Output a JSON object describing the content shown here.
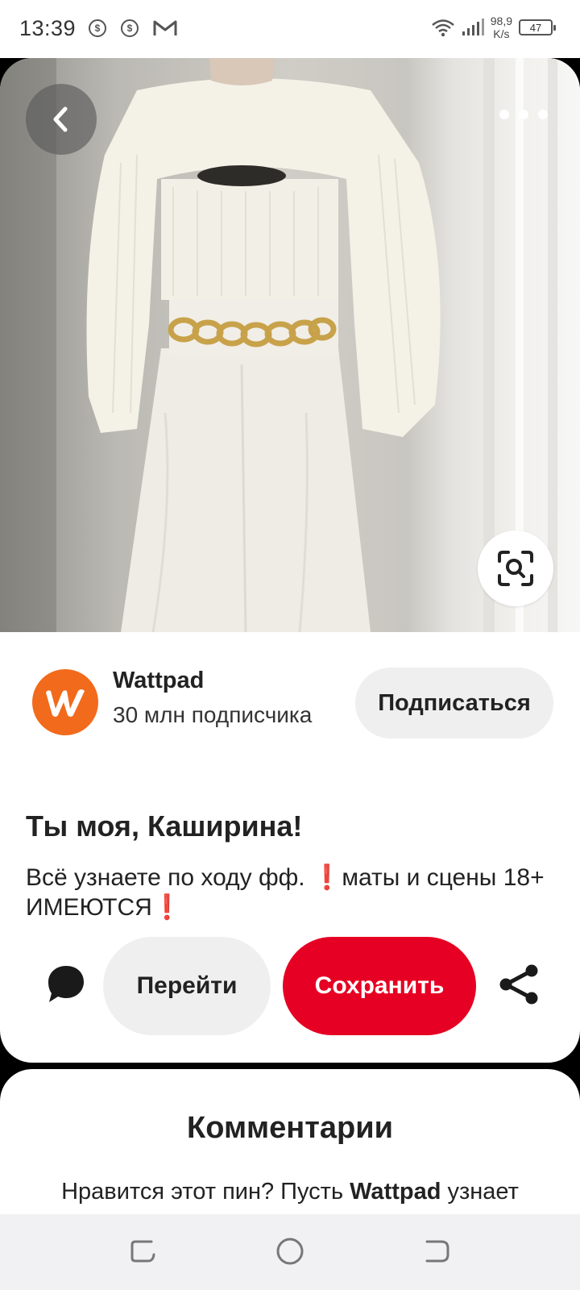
{
  "status_bar": {
    "time": "13:39",
    "net_speed_value": "98,9",
    "net_speed_unit": "K/s",
    "battery": "47",
    "notification_icons": [
      "app-notification-icon",
      "app-notification-icon",
      "gmail-icon"
    ]
  },
  "pin": {
    "image_alt_icons": [
      "back-icon",
      "more-icon",
      "visual-search-icon"
    ],
    "creator": {
      "name": "Wattpad",
      "followers": "30 млн подписчика",
      "follow_label": "Подписаться",
      "avatar_color": "#f26a1b"
    },
    "title": "Ты моя, Каширина!",
    "description": "Всё узнаете по ходу фф. ❗маты и сцены 18+ ИМЕЮТСЯ❗",
    "actions": {
      "go_label": "Перейти",
      "save_label": "Сохранить",
      "save_color": "#e60023"
    }
  },
  "comments": {
    "title": "Комментарии",
    "prompt_before": "Нравится этот пин? Пусть ",
    "prompt_name": "Wattpad",
    "prompt_after": " узнает"
  },
  "nav_bar": {
    "icons": [
      "recents-icon",
      "home-icon",
      "back-nav-icon"
    ]
  }
}
